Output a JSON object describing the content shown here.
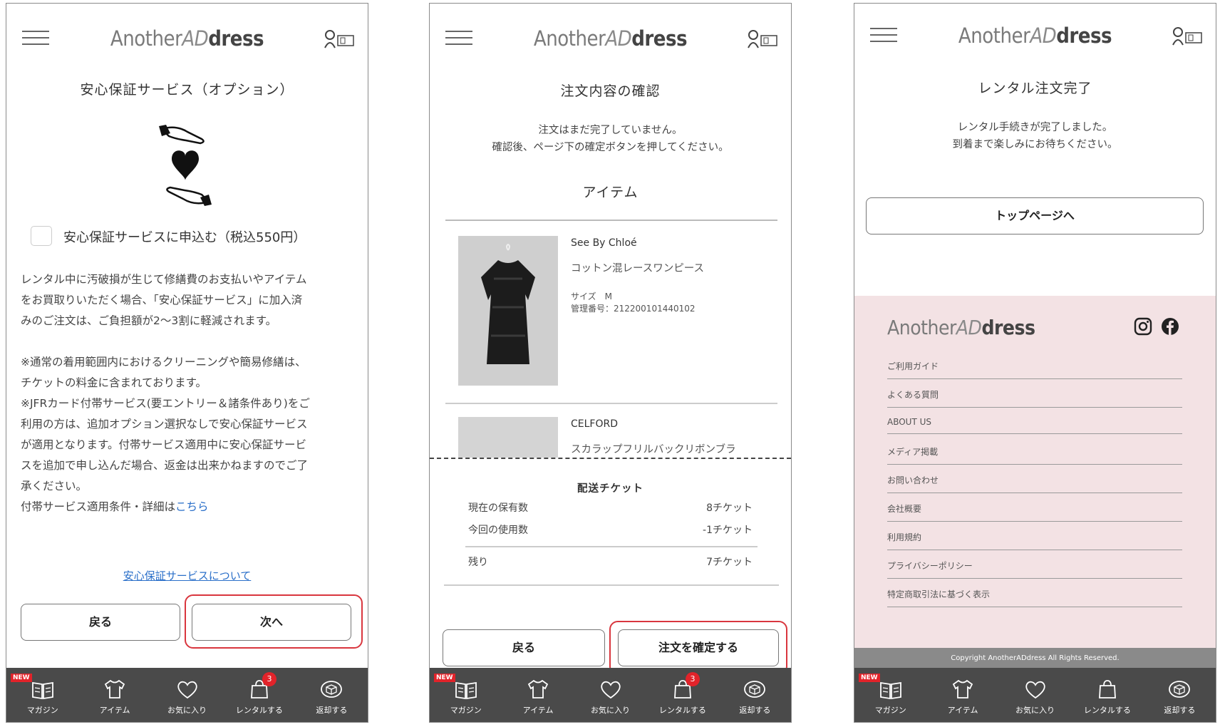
{
  "brand": {
    "part1": "Another",
    "part2": "AD",
    "part3": "dress"
  },
  "tabbar": {
    "new_tag": "NEW",
    "badge": "3",
    "items": [
      "マガジン",
      "アイテム",
      "お気に入り",
      "レンタルする",
      "返却する"
    ]
  },
  "screen1": {
    "title": "安心保証サービス（オプション）",
    "checkbox_label": "安心保証サービスに申込む（税込550円）",
    "para1": [
      "レンタル中に汚破損が生じて修繕費のお支払いやアイテム",
      "をお買取りいただく場合、「安心保証サービス」に加入済",
      "みのご注文は、ご負担額が2〜3割に軽減されます。"
    ],
    "para2": [
      "※通常の着用範囲内におけるクリーニングや簡易修繕は、",
      "チケットの料金に含まれております。",
      "※JFRカード付帯サービス(要エントリー＆諸条件あり)をご",
      "利用の方は、追加オプション選択なしで安心保証サービス",
      "が適用となります。付帯サービス適用中に安心保証サービ",
      "スを追加で申し込んだ場合、返金は出来かねますのでご了",
      "承ください。"
    ],
    "detail_prefix": "付帯サービス適用条件・詳細は",
    "detail_link": "こちら",
    "about_link": "安心保証サービスについて",
    "back_button": "戻る",
    "next_button": "次へ"
  },
  "screen2": {
    "title": "注文内容の確認",
    "notice1": "注文はまだ完了していません。",
    "notice2": "確認後、ページ下の確定ボタンを押してください。",
    "items_heading": "アイテム",
    "items": [
      {
        "brand": "See By Chloé",
        "name": "コットン混レースワンピース",
        "size": "サイズ　M",
        "code": "管理番号：212200101440102"
      },
      {
        "brand": "CELFORD",
        "name": "スカラップフリルバックリボンブラ"
      }
    ],
    "ticket_heading": "配送チケット",
    "rows": [
      {
        "label": "現在の保有数",
        "value": "8チケット"
      },
      {
        "label": "今回の使用数",
        "value": "-1チケット"
      },
      {
        "label": "残り",
        "value": "7チケット"
      }
    ],
    "back_button": "戻る",
    "confirm_button": "注文を確定する"
  },
  "screen3": {
    "title": "レンタル注文完了",
    "message1": "レンタル手続きが完了しました。",
    "message2": "到着まで楽しみにお待ちください。",
    "top_button": "トップページへ",
    "footer_links": [
      "ご利用ガイド",
      "よくある質問",
      "ABOUT US",
      "メディア掲載",
      "お問い合わせ",
      "会社概要",
      "利用規約",
      "プライバシーポリシー",
      "特定商取引法に基づく表示"
    ],
    "copyright": "Copyright AnotherADdress All Rights Reserved."
  }
}
